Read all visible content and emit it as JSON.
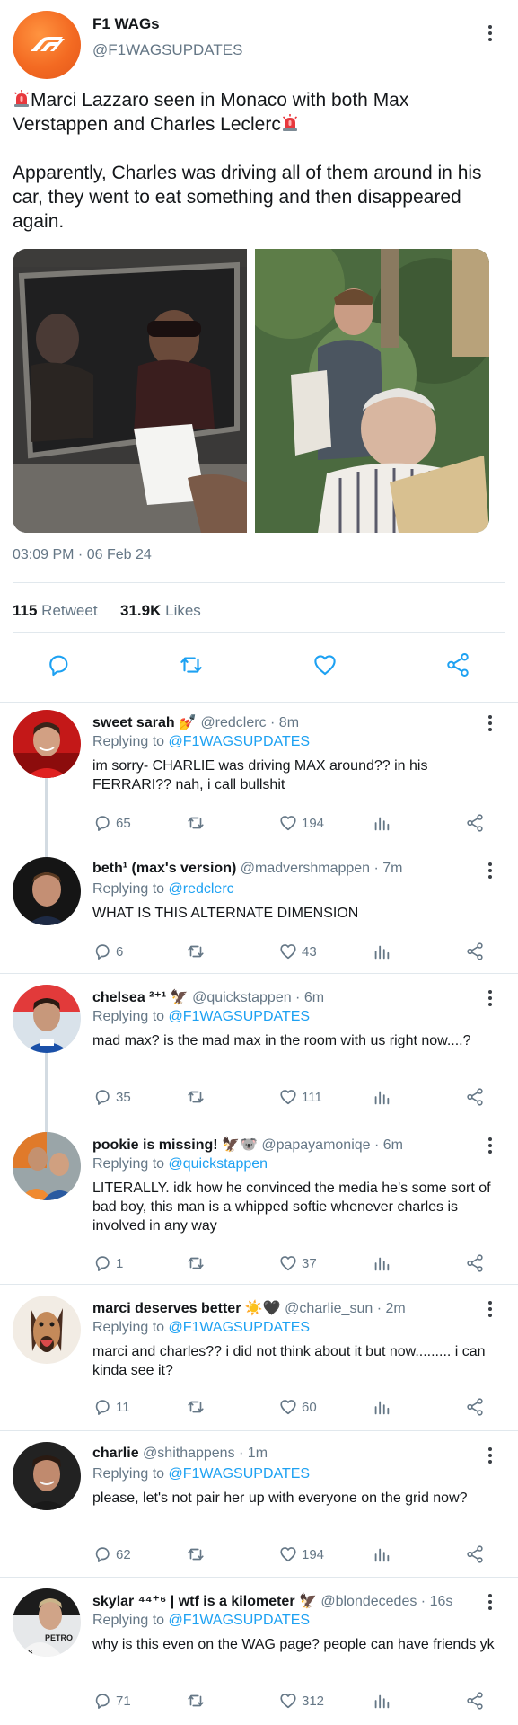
{
  "tweet": {
    "author_name": "F1 WAGs",
    "author_handle": "@F1WAGSUPDATES",
    "line1": "Marci Lazzaro seen in Monaco with both Max Verstappen and Charles Leclerc",
    "line2": "Apparently, Charles was driving all of them around in his car, they went to eat something and then disappeared again.",
    "timestamp": "03:09 PM · 06 Feb 24",
    "retweet_count": "115",
    "retweet_label": "Retweet",
    "likes_count": "31.9K",
    "likes_label": "Likes"
  },
  "replies": [
    {
      "name": "sweet sarah 💅",
      "handle": "@redclerc · 8m",
      "replying_label": "Replying to ",
      "replying_to": "@F1WAGSUPDATES",
      "text": "im sorry- CHARLIE was driving MAX around?? in his FERRARI?? nah, i call bullshit",
      "replies": "65",
      "likes": "194"
    },
    {
      "name": "beth¹ (max's version)",
      "handle": "@madvershmappen · 7m",
      "replying_label": "Replying to ",
      "replying_to": "@redclerc",
      "text": "WHAT IS THIS ALTERNATE DIMENSION",
      "replies": "6",
      "likes": "43"
    },
    {
      "name": "chelsea ²⁺¹ 🦅",
      "handle": "@quickstappen · 6m",
      "replying_label": "Replying to ",
      "replying_to": "@F1WAGSUPDATES",
      "text": "mad max? is the mad max in the room with us right now....?",
      "replies": "35",
      "likes": "111"
    },
    {
      "name": "pookie is missing! 🦅🐨",
      "handle": "@papayamoniqe · 6m",
      "replying_label": "Replying to ",
      "replying_to": "@quickstappen",
      "text": "LITERALLY. idk how he convinced the media he's some sort of bad boy, this man is a whipped softie whenever charles is involved in any way",
      "replies": "1",
      "likes": "37"
    },
    {
      "name": "marci deserves better ☀️🖤",
      "handle": "@charlie_sun · 2m",
      "replying_label": "Replying to ",
      "replying_to": "@F1WAGSUPDATES",
      "text": "marci and charles?? i did not think about it but now......... i can kinda see it?",
      "replies": "11",
      "likes": "60"
    },
    {
      "name": "charlie",
      "handle": "@shithappens · 1m",
      "replying_label": "Replying to ",
      "replying_to": "@F1WAGSUPDATES",
      "text": "please, let's not pair her up with everyone on the grid now?",
      "replies": "62",
      "likes": "194"
    },
    {
      "name": "skylar ⁴⁴⁺⁶ | wtf is a kilometer 🦅",
      "handle": "@blondecedes · 16s",
      "replying_label": "Replying to ",
      "replying_to": "@F1WAGSUPDATES",
      "text": "why is this even on the WAG page? people can have friends yk",
      "replies": "71",
      "likes": "312"
    }
  ],
  "colors": {
    "accent": "#1da1f2",
    "text_primary": "#14171a",
    "text_secondary": "#657786",
    "divider": "#e1e8ed",
    "brand_orange": "#f36a22"
  },
  "icons": [
    "f1-logo-icon",
    "siren-icon",
    "more-icon",
    "reply-icon",
    "retweet-icon",
    "like-icon",
    "analytics-icon",
    "share-icon"
  ]
}
